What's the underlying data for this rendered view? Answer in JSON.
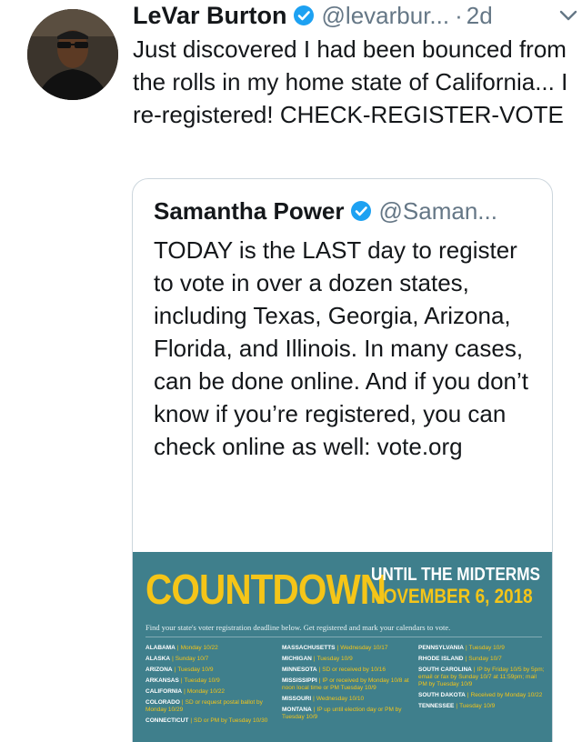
{
  "tweet": {
    "author_name": "LeVar Burton",
    "handle": "@levarbur...",
    "separator": "·",
    "time": "2d",
    "text": "Just discovered I had been bounced from the rolls in my home state of California... I re-registered! CHECK-REGISTER-VOTE"
  },
  "quoted_tweet": {
    "author_name": "Samantha Power",
    "handle": "@Saman...",
    "text": "TODAY is the LAST day to register to vote in over a dozen states, including Texas, Georgia, Arizona, Florida, and Illinois. In many cases, can be done online. And if you don’t know if you’re registered, you can check online as well: vote.org"
  },
  "infographic": {
    "title": "COUNTDOWN",
    "subtitle_top": "UNTIL THE MIDTERMS",
    "subtitle_date": "NOVEMBER 6, 2018",
    "instruction": "Find your state's voter registration deadline below. Get registered and mark your calendars to vote.",
    "columns": [
      [
        {
          "state": "ALABAMA",
          "deadline": "Monday 10/22"
        },
        {
          "state": "ALASKA",
          "deadline": "Sunday 10/7"
        },
        {
          "state": "ARIZONA",
          "deadline": "Tuesday 10/9"
        },
        {
          "state": "ARKANSAS",
          "deadline": "Tuesday 10/9"
        },
        {
          "state": "CALIFORNIA",
          "deadline": "Monday 10/22"
        },
        {
          "state": "COLORADO",
          "deadline": "SD or request postal ballot by Monday 10/29"
        },
        {
          "state": "CONNECTICUT",
          "deadline": "SD or PM by Tuesday 10/30"
        }
      ],
      [
        {
          "state": "MASSACHUSETTS",
          "deadline": "Wednesday 10/17"
        },
        {
          "state": "MICHIGAN",
          "deadline": "Tuesday 10/9"
        },
        {
          "state": "MINNESOTA",
          "deadline": "SD or received by 10/16"
        },
        {
          "state": "MISSISSIPPI",
          "deadline": "IP or received by Monday 10/8 at noon local time or PM Tuesday 10/9"
        },
        {
          "state": "MISSOURI",
          "deadline": "Wednesday 10/10"
        },
        {
          "state": "MONTANA",
          "deadline": "IP up until election day or PM by Tuesday 10/9"
        }
      ],
      [
        {
          "state": "PENNSYLVANIA",
          "deadline": "Tuesday 10/9"
        },
        {
          "state": "RHODE ISLAND",
          "deadline": "Sunday 10/7"
        },
        {
          "state": "SOUTH CAROLINA",
          "deadline": "IP by Friday 10/5 by 5pm; email or fax by Sunday 10/7 at 11:59pm; mail PM by Tuesday 10/9"
        },
        {
          "state": "SOUTH DAKOTA",
          "deadline": "Received by Monday 10/22"
        },
        {
          "state": "TENNESSEE",
          "deadline": "Tuesday 10/9"
        }
      ]
    ]
  },
  "colors": {
    "text": "#14171a",
    "secondary": "#657786",
    "verified": "#1da1f2",
    "infographic_bg": "#3f7f8c",
    "infographic_accent": "#f5c518"
  },
  "icons": {
    "verified": "verified-badge-icon",
    "caret": "chevron-down-icon"
  }
}
